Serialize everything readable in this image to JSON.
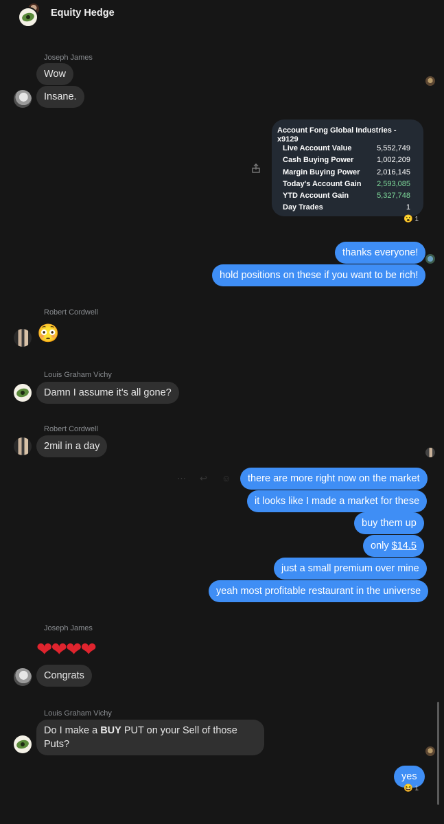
{
  "header": {
    "title": "Equity Hedge"
  },
  "messages": {
    "m1": {
      "sender": "Joseph James",
      "b1": "Wow",
      "b2": "Insane."
    },
    "card": {
      "title": "Account Fong Global Industries - x9129",
      "rows": [
        {
          "label": "Live Account Value",
          "value": "5,552,749"
        },
        {
          "label": "Cash Buying Power",
          "value": "1,002,209"
        },
        {
          "label": "Margin Buying Power",
          "value": "2,016,145"
        },
        {
          "label": "Today's Account Gain",
          "value": "2,593,085"
        },
        {
          "label": "YTD Account Gain",
          "value": "5,327,748"
        },
        {
          "label": "Day Trades",
          "value": "1"
        }
      ],
      "reaction_count": "1",
      "reaction_emoji": "😮"
    },
    "out1": {
      "b1": "thanks everyone!",
      "b2": "hold positions on these if you want to be rich!"
    },
    "m2": {
      "sender": "Robert Cordwell",
      "emoji": "😳"
    },
    "m3": {
      "sender": "Louis Graham Vichy",
      "b1": "Damn I assume it's all gone?"
    },
    "m4": {
      "sender": "Robert Cordwell",
      "b1": "2mil in a day"
    },
    "out2": {
      "b1": "there are more right now on the market",
      "b2": "it looks like I made a market for these",
      "b3": "buy them up",
      "b4_prefix": "only ",
      "b4_link": "$14.5",
      "b5": "just a small premium over mine",
      "b6": "yeah most profitable restaurant in the universe"
    },
    "m5": {
      "sender": "Joseph James",
      "hearts": "❤❤❤❤",
      "b1": "Congrats"
    },
    "m6": {
      "sender": "Louis Graham Vichy",
      "line1_pre": "Do I make a ",
      "line1_bold": "BUY",
      "line1_post": " PUT on your Sell of those",
      "line2": "Puts?"
    },
    "out3": {
      "b1": "yes",
      "reaction_count": "1",
      "reaction_emoji": "😆"
    }
  },
  "icons": {
    "share": "share-icon",
    "more": "more-icon",
    "reply": "reply-icon",
    "react": "react-icon"
  }
}
